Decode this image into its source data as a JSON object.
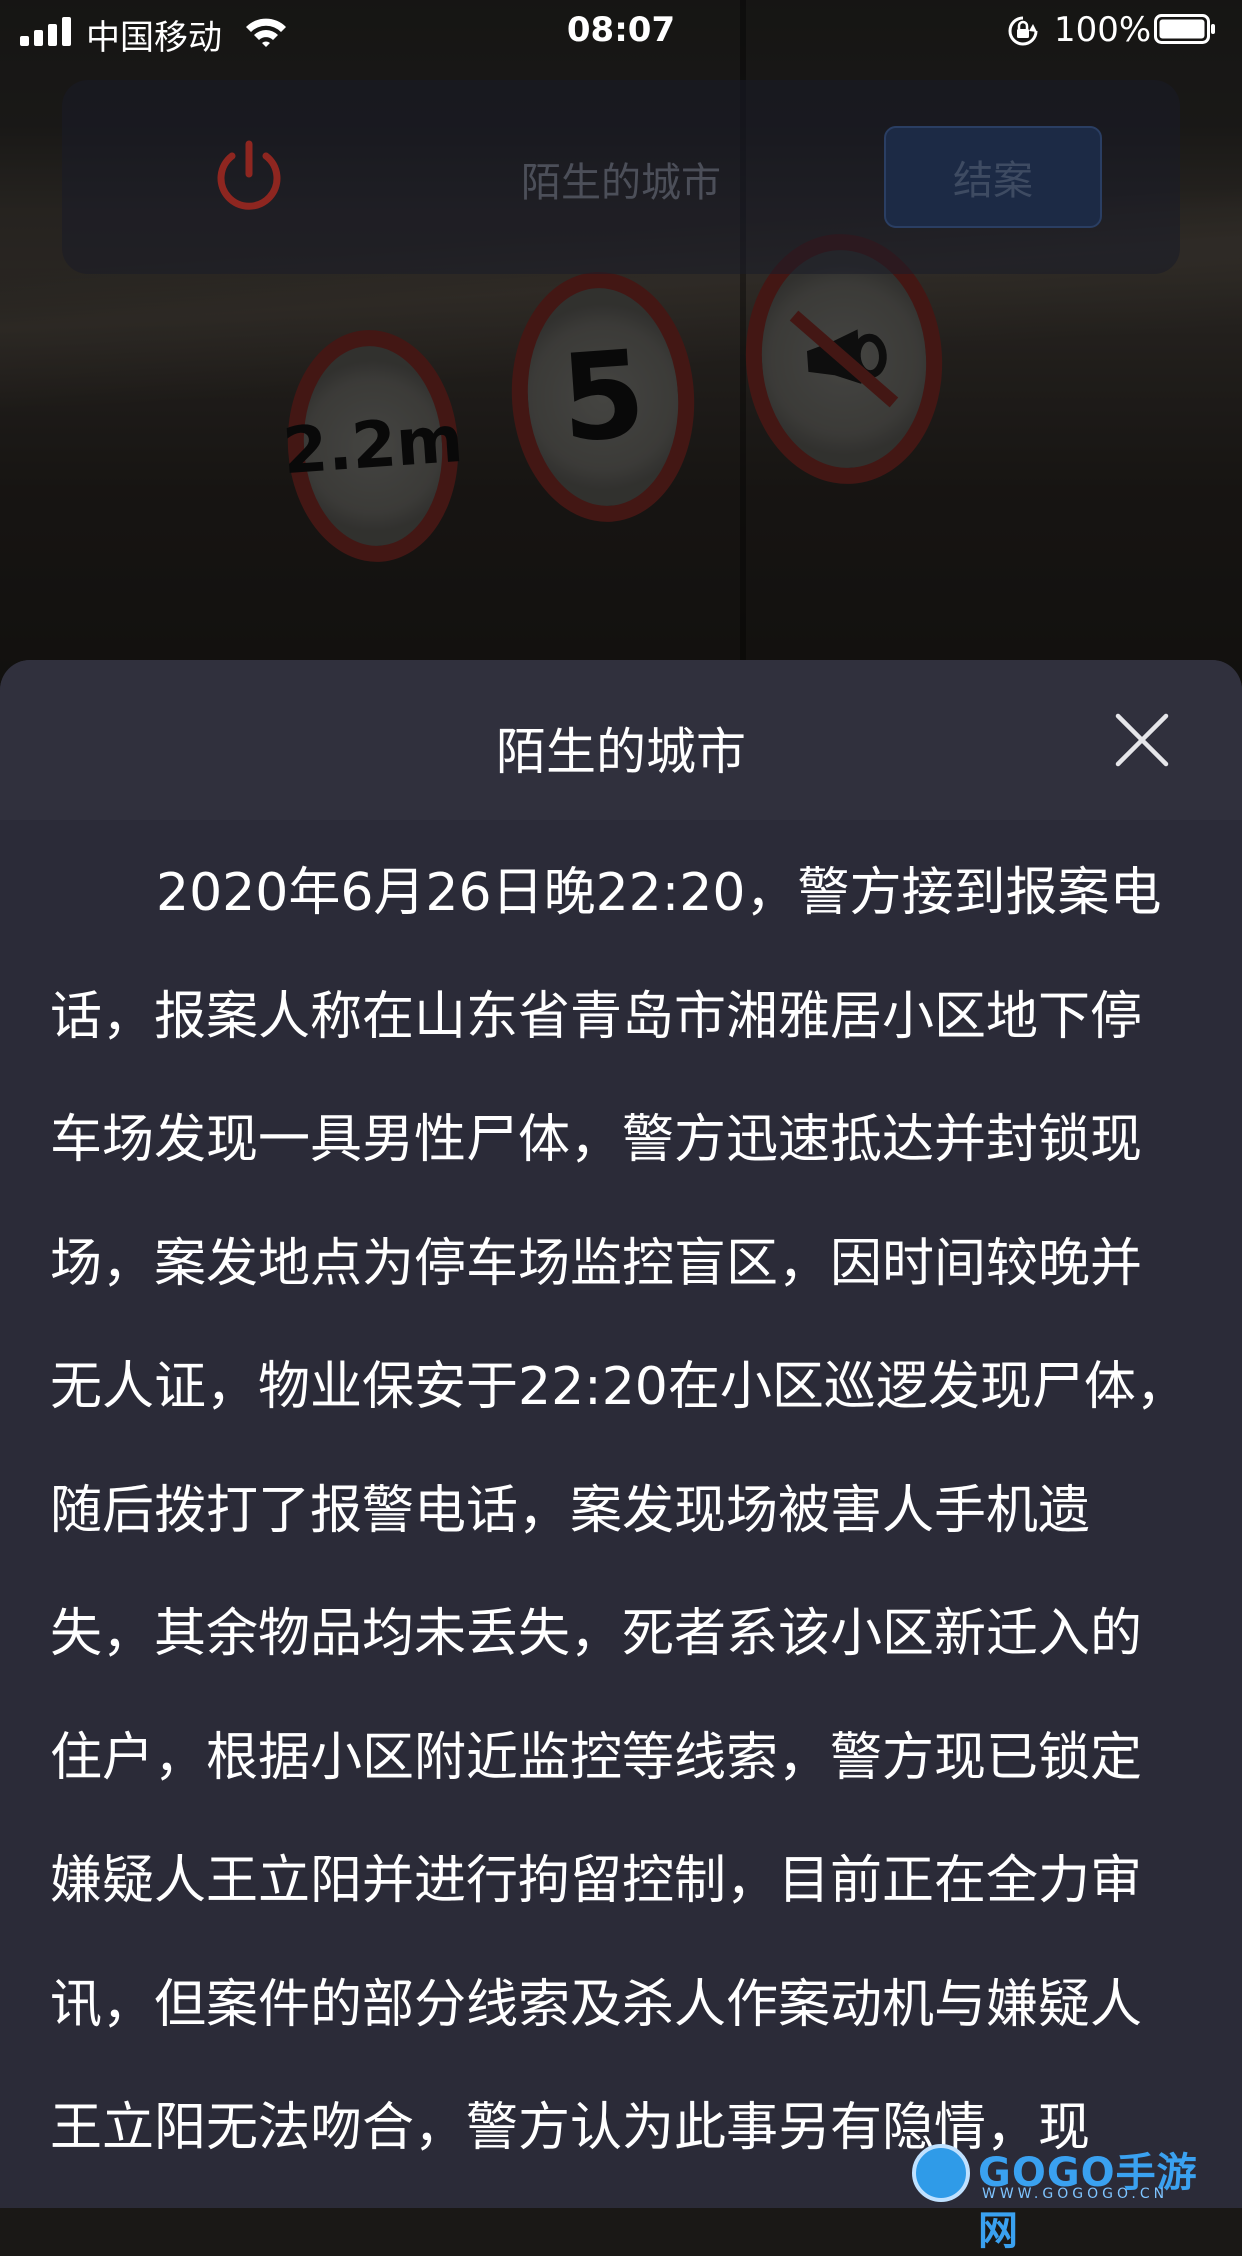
{
  "status_bar": {
    "carrier": "中国移动",
    "time": "08:07",
    "battery_percent": "100%"
  },
  "top_bar": {
    "title": "陌生的城市",
    "close_case_label": "结案"
  },
  "scene": {
    "height_sign": "2.2m",
    "speed_sign": "5"
  },
  "modal": {
    "title": "陌生的城市",
    "body": "2020年6月26日晚22:20，警方接到报案电话，报案人称在山东省青岛市湘雅居小区地下停车场发现一具男性尸体，警方迅速抵达并封锁现场，案发地点为停车场监控盲区，因时间较晚并无人证，物业保安于22:20在小区巡逻发现尸体，随后拨打了报警电话，案发现场被害人手机遗失，其余物品均未丢失，死者系该小区新迁入的住户，根据小区附近监控等线索，警方现已锁定嫌疑人王立阳并进行拘留控制，目前正在全力审讯，但案件的部分线索及杀人作案动机与嫌疑人王立阳无法吻合，警方认为此事另有隐情，现"
  },
  "watermark": {
    "brand": "GOGO手游网",
    "url": "WWW.GOGOGO.CN"
  },
  "colors": {
    "sheet_bg": "#2b2b38",
    "header_bg": "#30303d",
    "power_red": "#8e2620",
    "button_blue": "#1c2a45"
  }
}
